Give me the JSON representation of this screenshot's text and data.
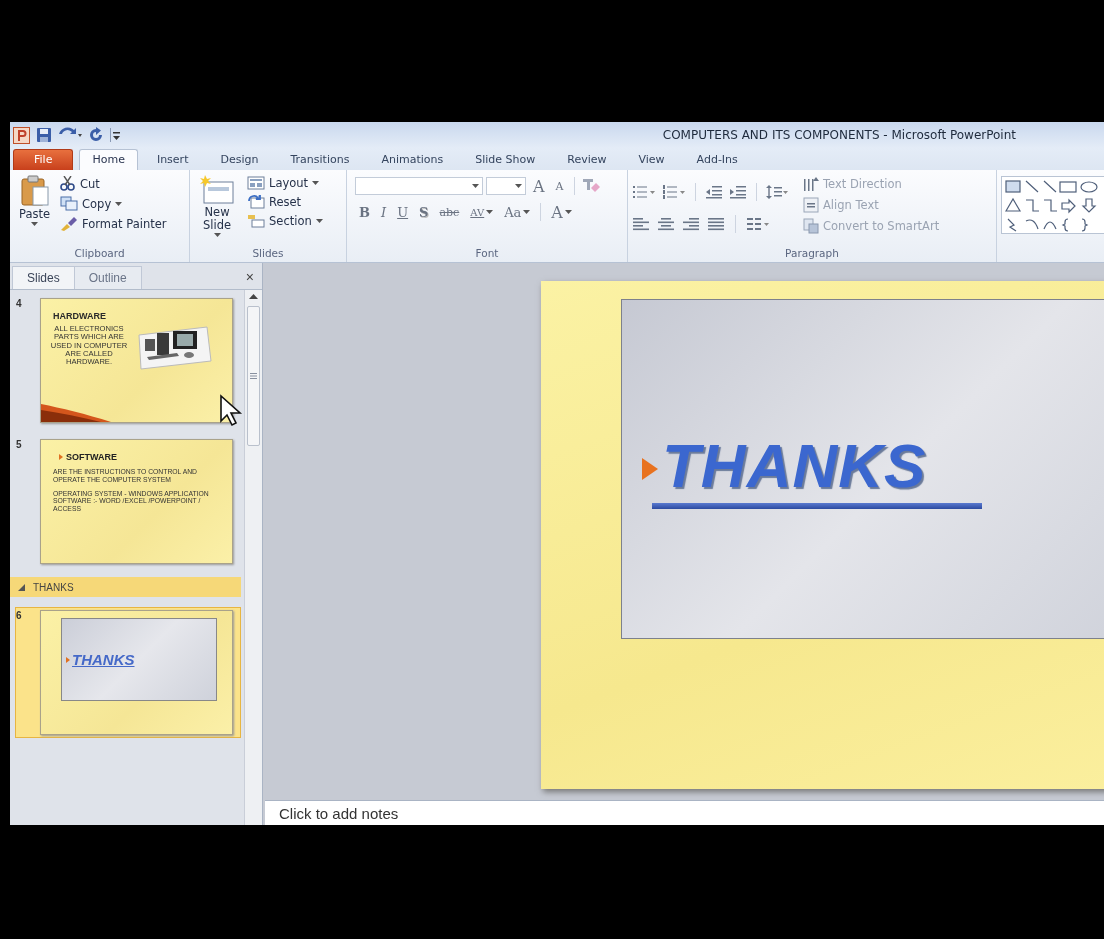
{
  "window": {
    "title": "COMPUTERS AND ITS COMPONENTS  -  Microsoft PowerPoint"
  },
  "tabs": [
    {
      "label": "File",
      "kind": "file",
      "selected": false
    },
    {
      "label": "Home",
      "kind": "tab",
      "selected": true
    },
    {
      "label": "Insert",
      "kind": "tab",
      "selected": false
    },
    {
      "label": "Design",
      "kind": "tab",
      "selected": false
    },
    {
      "label": "Transitions",
      "kind": "tab",
      "selected": false
    },
    {
      "label": "Animations",
      "kind": "tab",
      "selected": false
    },
    {
      "label": "Slide Show",
      "kind": "tab",
      "selected": false
    },
    {
      "label": "Review",
      "kind": "tab",
      "selected": false
    },
    {
      "label": "View",
      "kind": "tab",
      "selected": false
    },
    {
      "label": "Add-Ins",
      "kind": "tab",
      "selected": false
    }
  ],
  "ribbon": {
    "clipboard": {
      "label": "Clipboard",
      "paste": "Paste",
      "items": [
        {
          "label": "Cut",
          "dropdown": false
        },
        {
          "label": "Copy",
          "dropdown": true
        },
        {
          "label": "Format Painter",
          "dropdown": false
        }
      ]
    },
    "slides": {
      "label": "Slides",
      "new_slide": "New Slide",
      "items": [
        {
          "label": "Layout",
          "dropdown": true
        },
        {
          "label": "Reset",
          "dropdown": false
        },
        {
          "label": "Section",
          "dropdown": true
        }
      ]
    },
    "font": {
      "label": "Font",
      "size_buttons": [
        {
          "label": "A",
          "kind": "grow"
        },
        {
          "label": "A",
          "kind": "shrink"
        }
      ],
      "buttons": [
        {
          "label": "B",
          "kind": "bold",
          "dropdown": false
        },
        {
          "label": "I",
          "kind": "italic",
          "dropdown": false
        },
        {
          "label": "U",
          "kind": "underline",
          "dropdown": false
        },
        {
          "label": "S",
          "kind": "shadow",
          "dropdown": false
        },
        {
          "label": "abc",
          "kind": "strike",
          "dropdown": false
        },
        {
          "label": "AV",
          "kind": "spacing",
          "dropdown": true
        },
        {
          "label": "Aa",
          "kind": "case",
          "dropdown": true
        },
        {
          "label": "A",
          "kind": "color",
          "dropdown": true
        }
      ]
    },
    "paragraph": {
      "label": "Paragraph",
      "items": [
        {
          "label": "Text Direction",
          "disabled": true
        },
        {
          "label": "Align Text",
          "disabled": true
        },
        {
          "label": "Convert to SmartArt",
          "disabled": true
        }
      ]
    }
  },
  "pane": {
    "tabs": [
      {
        "label": "Slides",
        "selected": true
      },
      {
        "label": "Outline",
        "selected": false
      }
    ],
    "close": "×",
    "items": [
      {
        "kind": "text_picture_slide",
        "number": "4",
        "title": "HARDWARE",
        "body": [
          "ALL ELECTRONICS PARTS WHICH ARE USED IN COMPUTER ARE CALLED HARDWARE."
        ],
        "selected": false
      },
      {
        "kind": "text_slide",
        "number": "5",
        "title": "SOFTWARE",
        "body": [
          "ARE THE INSTRUCTIONS TO CONTROL AND OPERATE THE COMPUTER SYSTEM",
          "OPERATING SYSTEM - WINDOWS APPLICATION SOFTWARE :- WORD /EXCEL /POWERPOINT / ACCESS"
        ],
        "selected": false
      },
      {
        "kind": "section",
        "label": "THANKS",
        "expanded": true
      },
      {
        "kind": "title_slide",
        "number": "6",
        "title": "THANKS",
        "selected": true
      }
    ]
  },
  "editor": {
    "slide_title": "THANKS",
    "notes": {
      "placeholder": "Click to add notes"
    }
  }
}
